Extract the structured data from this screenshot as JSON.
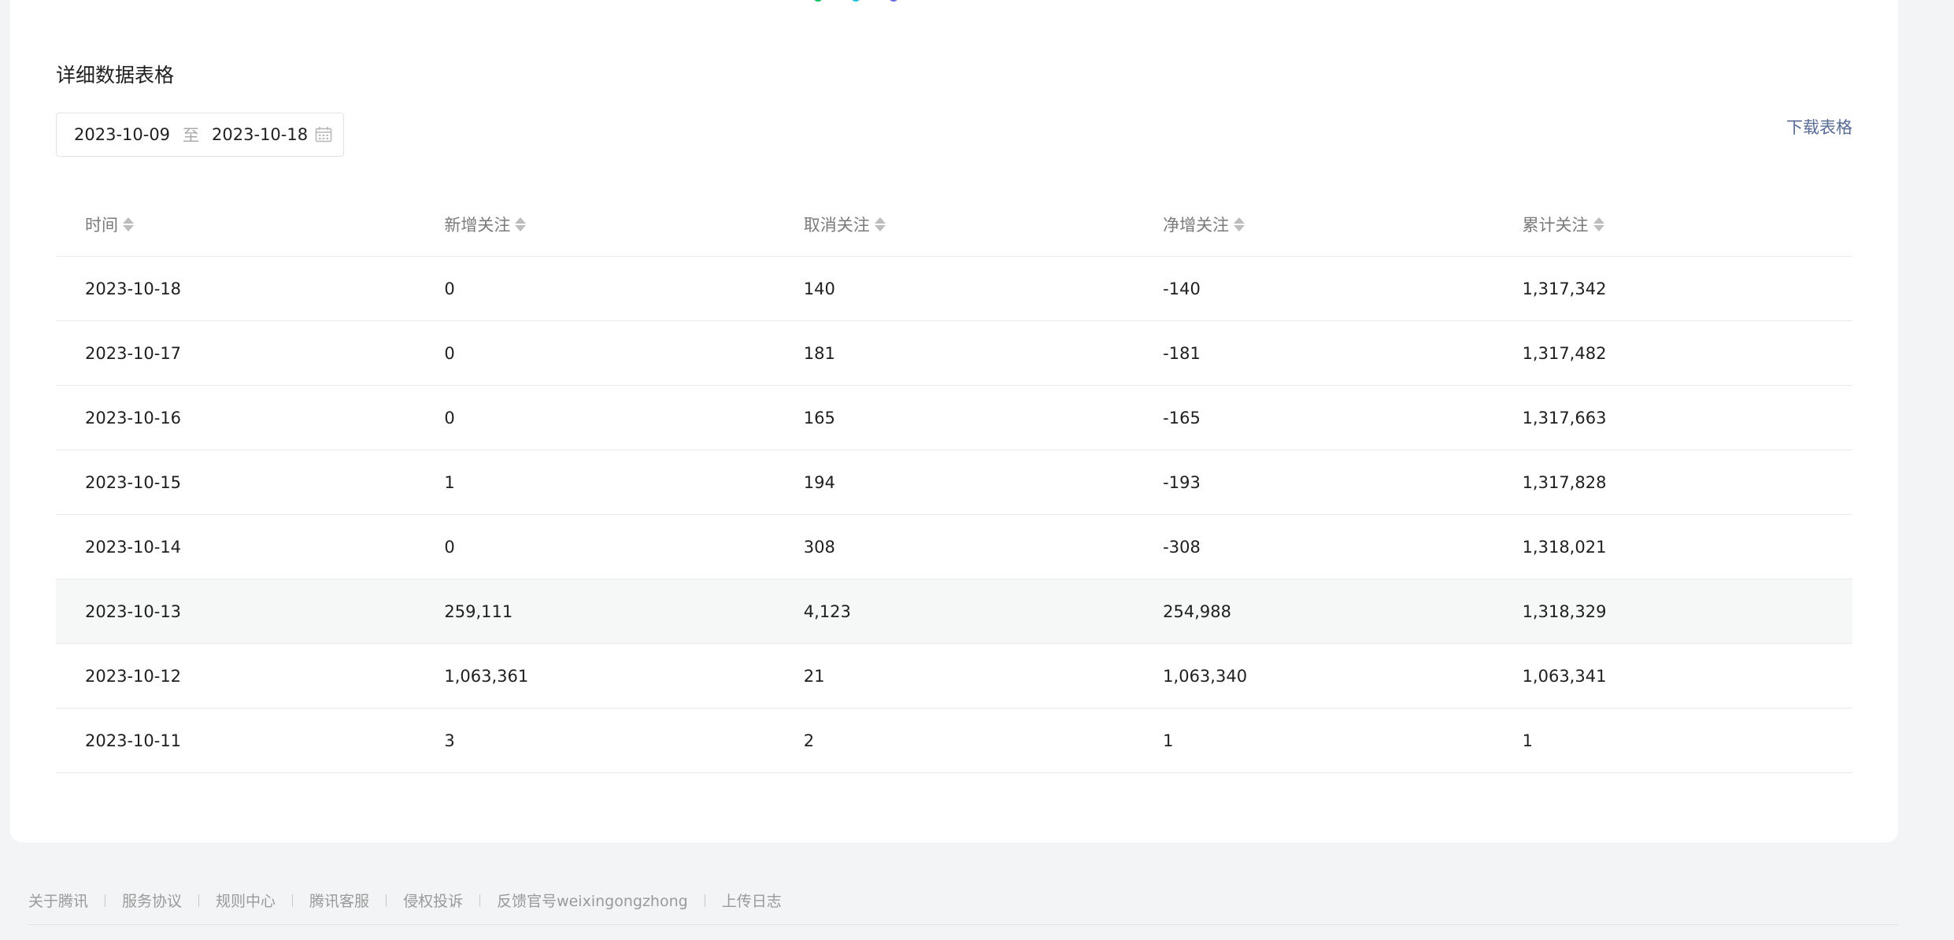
{
  "section": {
    "title": "详细数据表格"
  },
  "date_range": {
    "start": "2023-10-09",
    "separator": "至",
    "end": "2023-10-18"
  },
  "download_label": "下载表格",
  "table": {
    "headers": [
      "时间",
      "新增关注",
      "取消关注",
      "净增关注",
      "累计关注"
    ],
    "rows": [
      [
        "2023-10-18",
        "0",
        "140",
        "-140",
        "1,317,342"
      ],
      [
        "2023-10-17",
        "0",
        "181",
        "-181",
        "1,317,482"
      ],
      [
        "2023-10-16",
        "0",
        "165",
        "-165",
        "1,317,663"
      ],
      [
        "2023-10-15",
        "1",
        "194",
        "-193",
        "1,317,828"
      ],
      [
        "2023-10-14",
        "0",
        "308",
        "-308",
        "1,318,021"
      ],
      [
        "2023-10-13",
        "259,111",
        "4,123",
        "254,988",
        "1,318,329"
      ],
      [
        "2023-10-12",
        "1,063,361",
        "21",
        "1,063,340",
        "1,063,341"
      ],
      [
        "2023-10-11",
        "3",
        "2",
        "1",
        "1"
      ]
    ],
    "highlighted_row": 5
  },
  "footer": {
    "links": [
      "关于腾讯",
      "服务协议",
      "规则中心",
      "腾讯客服",
      "侵权投诉",
      "反馈官号weixingongzhong",
      "上传日志"
    ]
  },
  "colors": {
    "link": "#576b95",
    "legend_green": "#07c160",
    "legend_cyan": "#1ec2d6",
    "legend_purple": "#6a6ae0"
  }
}
